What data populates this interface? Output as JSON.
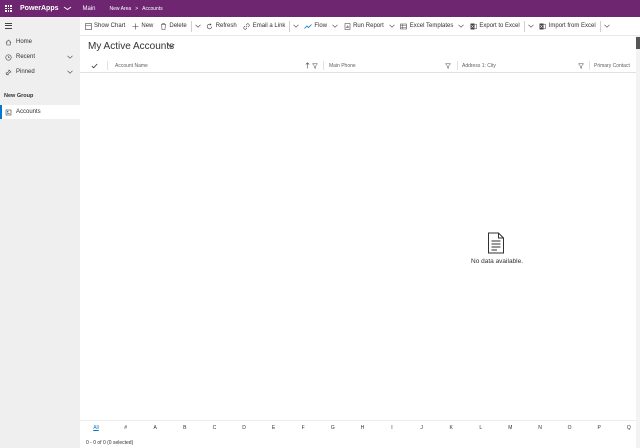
{
  "topbar": {
    "app_name": "PowerApps",
    "area": "Main",
    "breadcrumb": [
      "New Area",
      "Accounts"
    ]
  },
  "sidebar": {
    "items": [
      {
        "label": "Home",
        "icon": "home-icon"
      },
      {
        "label": "Recent",
        "icon": "clock-icon"
      },
      {
        "label": "Pinned",
        "icon": "pin-icon"
      }
    ],
    "group_title": "New Group",
    "active_item": {
      "label": "Accounts",
      "icon": "accounts-icon"
    }
  },
  "commands": {
    "show_chart": "Show Chart",
    "new": "New",
    "delete": "Delete",
    "refresh": "Refresh",
    "email_link": "Email a Link",
    "flow": "Flow",
    "run_report": "Run Report",
    "excel_templates": "Excel Templates",
    "export_excel": "Export to Excel",
    "import_excel": "Import from Excel"
  },
  "view": {
    "title": "My Active Accounts"
  },
  "grid": {
    "columns": [
      "Account Name",
      "Main Phone",
      "Address 1: City",
      "Primary Contact"
    ],
    "empty_message": "No data available."
  },
  "alphabet": [
    "All",
    "#",
    "A",
    "B",
    "C",
    "D",
    "E",
    "F",
    "G",
    "H",
    "I",
    "J",
    "K",
    "L",
    "M",
    "N",
    "O",
    "P",
    "Q"
  ],
  "footer": {
    "status": "0 - 0 of 0 (0 selected)"
  },
  "colors": {
    "topbar": "#6e2670",
    "accent": "#0078d4",
    "sidebar": "#efefef"
  }
}
